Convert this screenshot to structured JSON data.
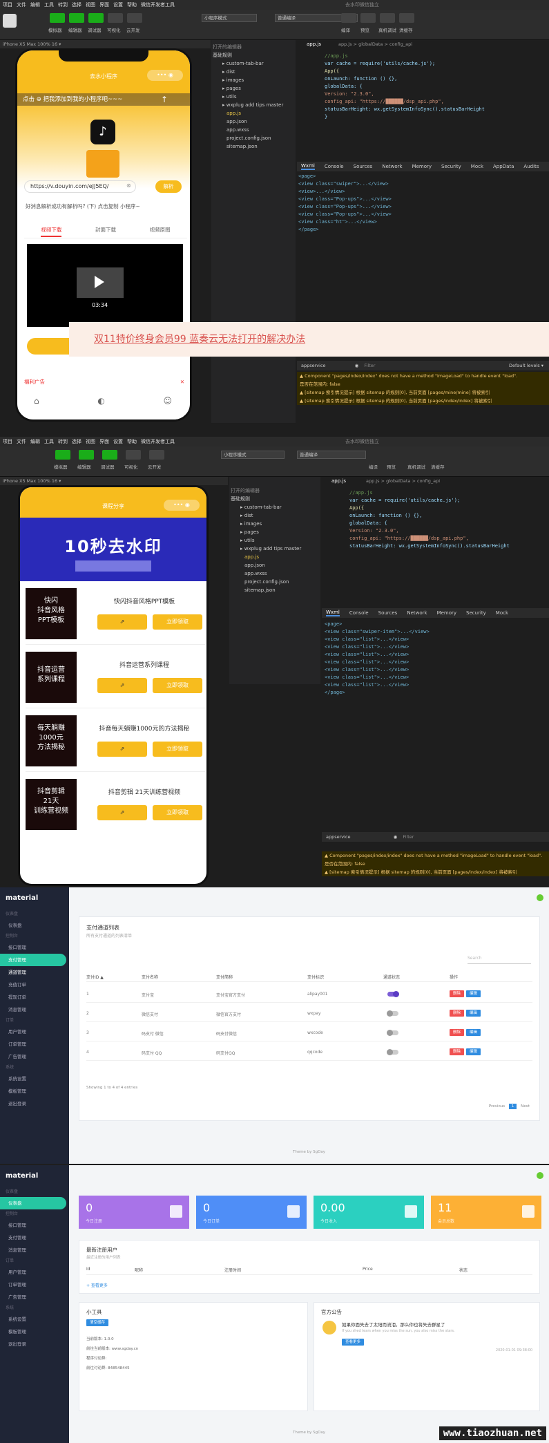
{
  "ide": {
    "menu": [
      "项目",
      "文件",
      "编辑",
      "工具",
      "转到",
      "选择",
      "视图",
      "界面",
      "设置",
      "帮助",
      "微信开发者工具"
    ],
    "window_title": "去水印微信独立",
    "toolbar_labels": [
      "模拟器",
      "编辑器",
      "调试器",
      "可视化",
      "云开发"
    ],
    "right_labels": [
      "编译",
      "预览",
      "真机调试",
      "清缓存"
    ],
    "mode_select": "小程序模式",
    "compile_select": "普通编译",
    "device": "iPhone X5 Max 100% 16 ▾",
    "file_tab": "app.js",
    "breadcrumb": "app.js > globalData > config_api",
    "tree_title": "打开的编辑器",
    "tree_root": "基础规则",
    "tree_items": [
      "custom-tab-bar",
      "dist",
      "images",
      "pages",
      "utils",
      "wxplug add tips master",
      "app.js",
      "app.json",
      "app.wxss",
      "project.config.json",
      "sitemap.json"
    ],
    "code": [
      "//app.js",
      "var cache = require('utils/cache.js');",
      "App({",
      "  onLaunch: function () {},",
      "  globalData: {",
      "    Version: \"2.3.0\",",
      "    config_api: \"https://██████/dsp_api.php\",",
      "    statusBarHeight: wx.getSystemInfoSync().statusBarHeight",
      "  }",
      "})"
    ],
    "devtabs": [
      "Wxml",
      "Console",
      "Sources",
      "Network",
      "Memory",
      "Security",
      "Mock",
      "AppData",
      "Audits"
    ],
    "wxml": [
      "<page>",
      "  <view class=\"swiper\">...</view>",
      "  <view>...</view>",
      "  <view class=\"Pop-ups\">...</view>",
      "  <view class=\"Pop-ups\">...</view>",
      "  <view class=\"Pop-ups\">...</view>",
      "  <view class=\"ht\">...</view>",
      "</page>"
    ],
    "wxml2": [
      "<page>",
      "  <view class=\"swiper-item\">...</view>",
      "  <view class=\"list\">...</view>",
      "  <view class=\"list\">...</view>",
      "  <view class=\"list\">...</view>",
      "  <view class=\"list\">...</view>",
      "  <view class=\"list\">...</view>",
      "  <view class=\"list\">...</view>",
      "  <view class=\"list\">...</view>",
      "</page>"
    ],
    "console_filter": "Filter",
    "console_scope": "appservice",
    "default_levels": "Default levels ▾",
    "console_lines": [
      "▲ Component \"pages/index/index\" does not have a method \"imageLoad\" to handle event \"load\".",
      "  是否在范围内: false",
      "▲ [sitemap 索引情况提示] 根据 sitemap 的规则[0], 当前页面 [pages/mine/mine] 将被索引",
      "▲ [sitemap 索引情况提示] 根据 sitemap 的规则[0], 当前页面 [pages/index/index] 将被索引"
    ]
  },
  "app1": {
    "nav_title": "去水小程序",
    "banner": "点击 ⊕ 把我添加到我的小程序吧~~~",
    "url_value": "https://v.douyin.com/eJJ5EQ/",
    "parse_btn": "解析",
    "tip": "好消息解析成功有解析吗?  (下) 点击复制  小程序~",
    "tabs": [
      "视频下载",
      "封面下载",
      "视频原图"
    ],
    "duration": "03:34",
    "promo": "双11特价终身会员99 蓝奏云无法打开的解决办法",
    "bottom_tip": "福利广告"
  },
  "app2": {
    "nav_title": "课程分享",
    "banner": "10秒去水印",
    "items": [
      {
        "cover": "快闪\n抖音风格\nPPT模板",
        "title": "快闪抖音风格PPT模板",
        "btn": "立即领取"
      },
      {
        "cover": "抖音运营\n系列课程",
        "title": "抖音运营系列课程",
        "btn": "立即领取"
      },
      {
        "cover": "每天躺赚\n1000元\n方法揭秘",
        "title": "抖音每天躺赚1000元的方法揭秘",
        "btn": "立即领取"
      },
      {
        "cover": "抖音剪辑\n21天\n训练营视频",
        "title": "抖音剪辑 21天训练营视频",
        "btn": "立即领取"
      }
    ]
  },
  "admin1": {
    "brand": "material",
    "sections": [
      "仪表盘",
      "控制台",
      "订单",
      "系统"
    ],
    "nav": [
      "仪表盘",
      "接口管理",
      "支付管理",
      "通道管理",
      "充值订单",
      "提现订单",
      "消息管理",
      "用户管理",
      "订单管理",
      "广告管理",
      "系统设置",
      "模板管理",
      "退出登录"
    ],
    "title": "支付通道列表",
    "subtitle": "所有支付通道的列表清单",
    "search": "Search",
    "columns": [
      "支付ID ▲",
      "支付名称",
      "支付简称",
      "支付标识",
      "通道状态",
      "操作"
    ],
    "rows": [
      {
        "id": "1",
        "name": "支付宝",
        "short": "支付宝官方支付",
        "tag": "alipay001",
        "on": true
      },
      {
        "id": "2",
        "name": "微信支付",
        "short": "微信官方支付",
        "tag": "wxpay",
        "on": false
      },
      {
        "id": "3",
        "name": "码支付 微信",
        "short": "码支付微信",
        "tag": "wxcode",
        "on": false
      },
      {
        "id": "4",
        "name": "码支付 QQ",
        "short": "码支付QQ",
        "tag": "qqcode",
        "on": false
      }
    ],
    "edit": "编辑",
    "del": "删除",
    "showing": "Showing 1 to 4 of 4 entries",
    "prev": "Previous",
    "page": "1",
    "next": "Next",
    "footer": "Theme by SgDay"
  },
  "admin2": {
    "stats": [
      {
        "value": "0",
        "label": "今日注册",
        "color": "#a873e8"
      },
      {
        "value": "0",
        "label": "今日订单",
        "color": "#4f8ef7"
      },
      {
        "value": "0.00",
        "label": "今日收入",
        "color": "#2bd0c0"
      },
      {
        "value": "11",
        "label": "会员总数",
        "color": "#fdb035"
      }
    ],
    "latest_title": "最新注册用户",
    "latest_sub": "最近注册的用户列表",
    "latest_cols": [
      "Id",
      "昵称",
      "注册时间",
      "Price",
      "状态"
    ],
    "more": "+ 查看更多",
    "tools_title": "小工具",
    "tools_btn": "清空缓存",
    "tools_lines": [
      "当前版本: 1.0.0",
      "前往当前版本: www.sgday.cn",
      "程序讨论群:  ",
      "前往讨论群: 848548445"
    ],
    "notice_title": "官方公告",
    "notice_text": "如果你面失去了太阳而流泪，那么你也将失去群星了",
    "notice_sub": "If you shed tears when you miss the sun, you also miss the stars.",
    "notice_btn": "查看更多",
    "notice_date": "2020-01-01 09:38:00",
    "footer": "Theme by SgDay",
    "watermark": "www.tiaozhuan.net"
  }
}
